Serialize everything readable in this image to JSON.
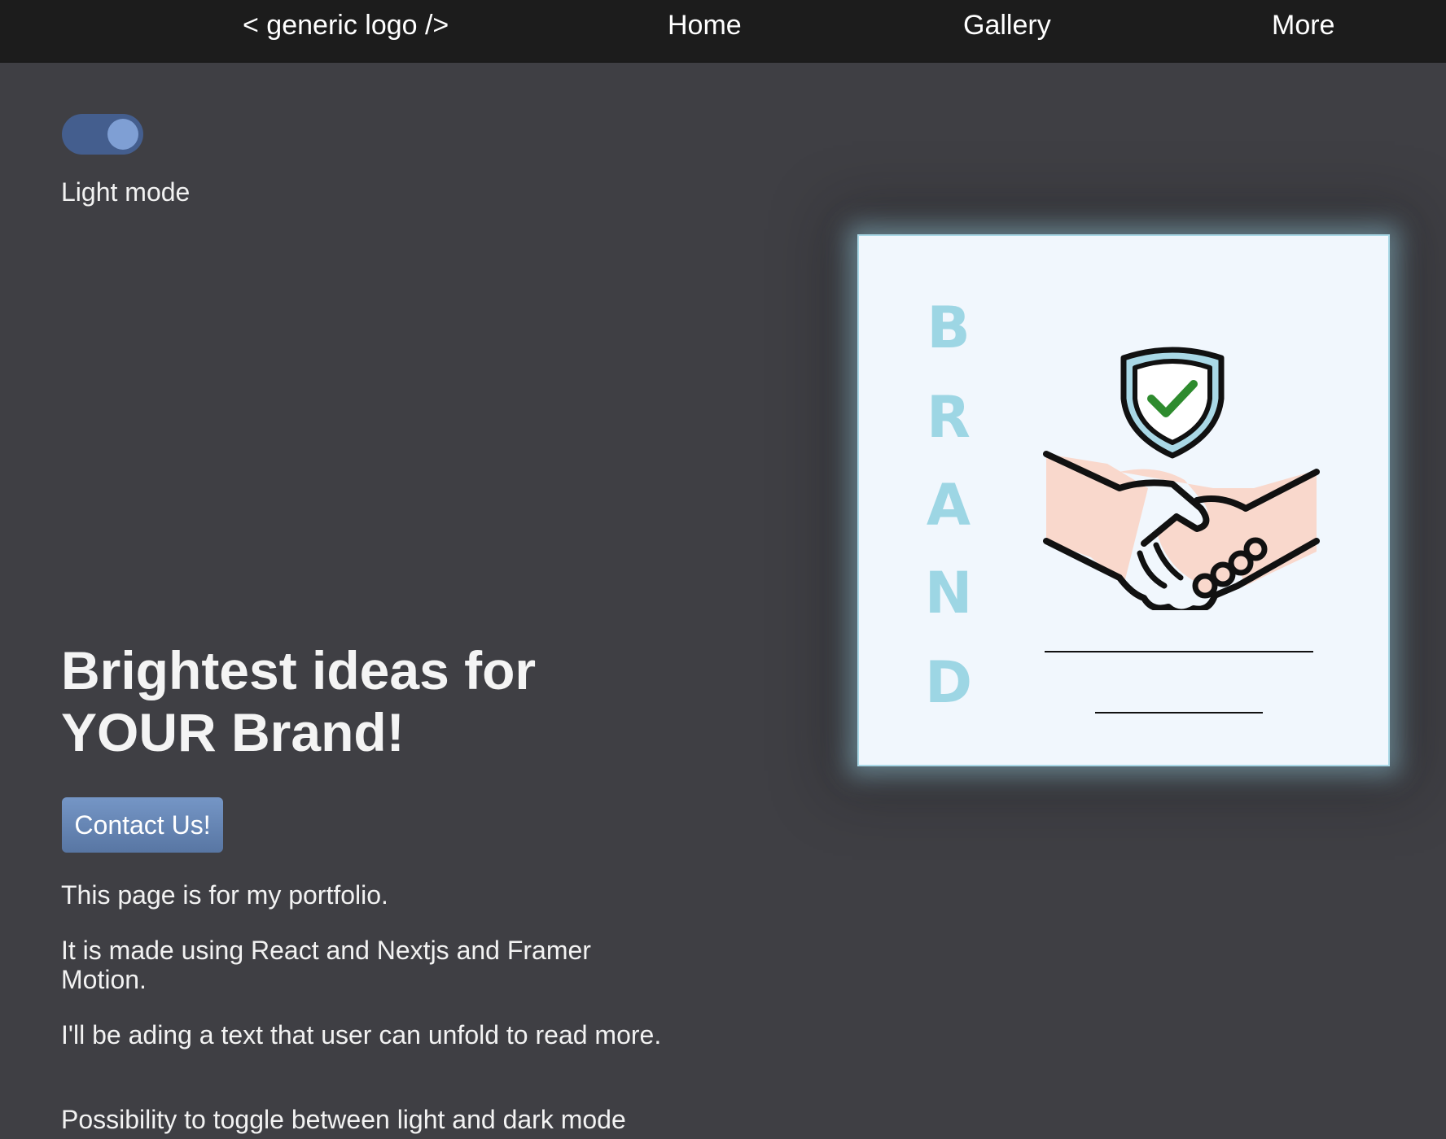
{
  "nav": {
    "logo": "< generic logo />",
    "items": [
      {
        "label": "Home"
      },
      {
        "label": "Gallery"
      },
      {
        "label": "More"
      }
    ]
  },
  "theme_toggle": {
    "state": "on",
    "label": "Light mode",
    "track_color": "#445e8e",
    "knob_color": "#7f9fd4"
  },
  "hero": {
    "headline_line1": "Brightest ideas for",
    "headline_line2": "YOUR Brand!",
    "cta_label": "Contact Us!",
    "paragraphs": [
      "This page is for my portfolio.",
      "It is made using React and Nextjs and Framer Motion.",
      "I'll be ading a text that user can unfold to read more.",
      "Possibility to toggle between light and dark mode"
    ]
  },
  "brand_card": {
    "letters": [
      "B",
      "R",
      "A",
      "N",
      "D"
    ],
    "icons": [
      "shield-check-icon",
      "handshake-icon"
    ],
    "letter_color": "#9dd6e4",
    "glow_color": "#a9d8e6"
  },
  "colors": {
    "background": "#3f3f44",
    "navbar": "#1c1c1c",
    "accent": "#5876a3"
  }
}
